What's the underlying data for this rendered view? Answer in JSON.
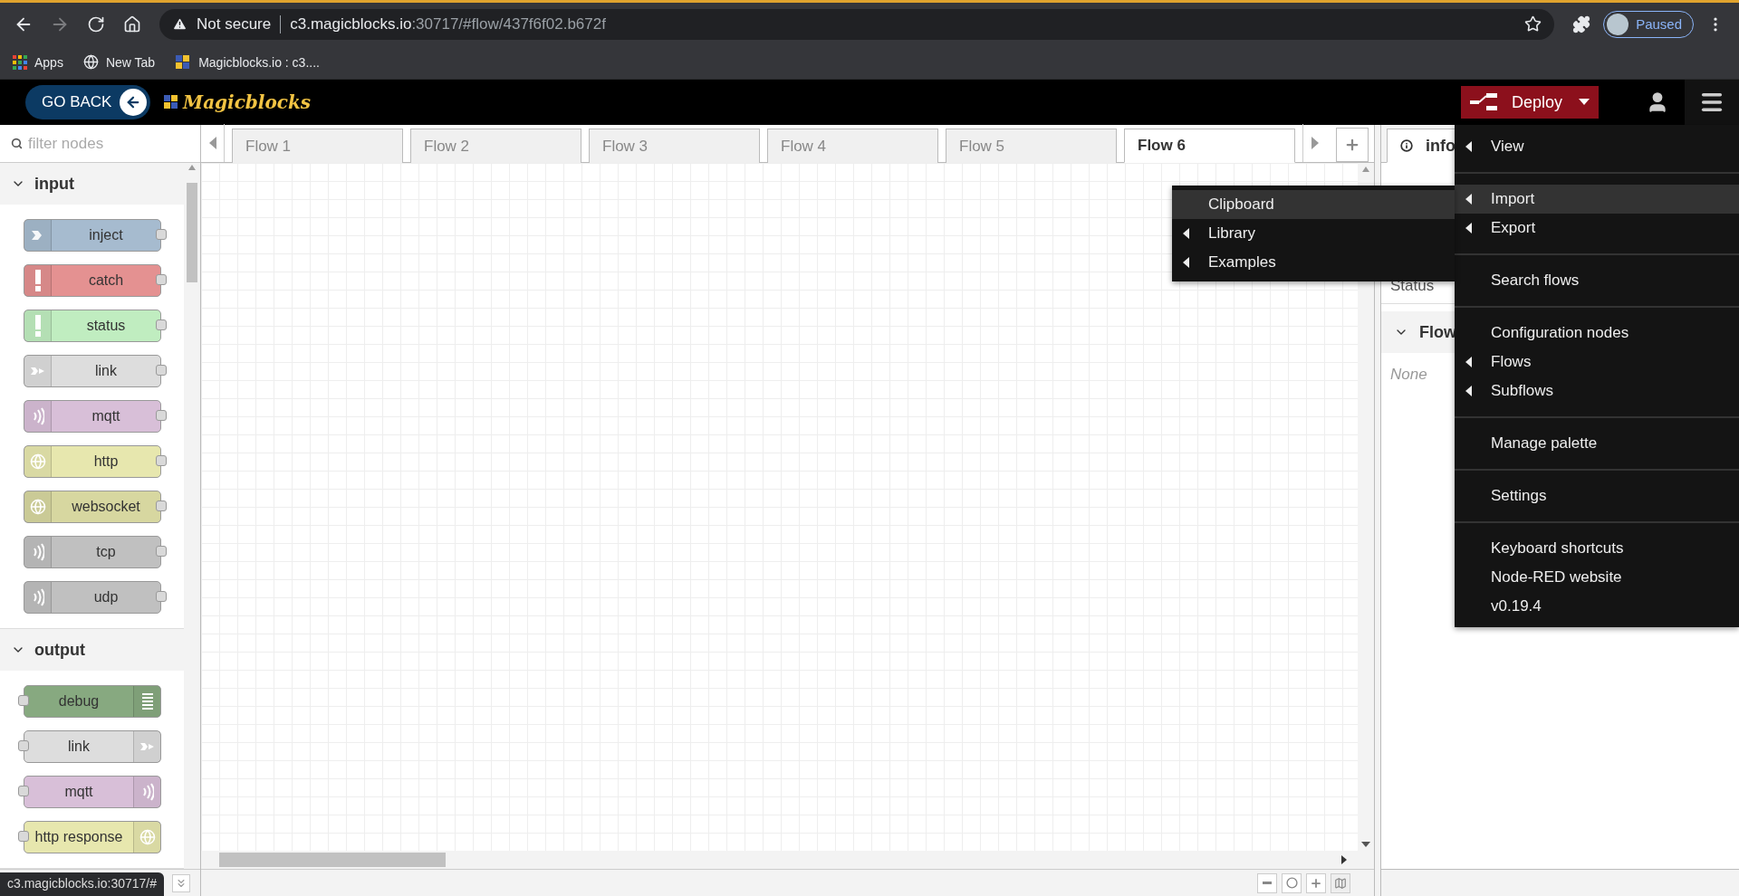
{
  "browser": {
    "security": "Not secure",
    "url_host": "c3.magicblocks.io",
    "url_rest": ":30717/#flow/437f6f02.b672f",
    "profile": "Paused",
    "forward_disabled": true
  },
  "bookmarks": [
    {
      "label": "Apps",
      "kind": "apps"
    },
    {
      "label": "New Tab",
      "kind": "globe"
    },
    {
      "label": "Magicblocks.io : c3....",
      "kind": "site"
    }
  ],
  "header": {
    "back_button": "GO BACK",
    "logo": "Magicblocks",
    "deploy": "Deploy",
    "menu_open": true
  },
  "palette": {
    "filter_placeholder": "filter nodes",
    "categories": [
      {
        "name": "input",
        "kind": "source",
        "expanded": true,
        "nodes": [
          {
            "label": "inject",
            "color": "#a6bbcf",
            "kind": "arrow"
          },
          {
            "label": "catch",
            "color": "#e49191",
            "kind": "alert"
          },
          {
            "label": "status",
            "color": "#c0edc0",
            "kind": "alert"
          },
          {
            "label": "link",
            "color": "#dddddd",
            "kind": "link"
          },
          {
            "label": "mqtt",
            "color": "#d8bfd8",
            "kind": "wave"
          },
          {
            "label": "http",
            "color": "#e7e7ae",
            "kind": "globe"
          },
          {
            "label": "websocket",
            "color": "#d7d7a0",
            "kind": "globe"
          },
          {
            "label": "tcp",
            "color": "#c0c0c0",
            "kind": "wave"
          },
          {
            "label": "udp",
            "color": "#c0c0c0",
            "kind": "wave"
          }
        ]
      },
      {
        "name": "output",
        "kind": "sink",
        "expanded": true,
        "nodes": [
          {
            "label": "debug",
            "color": "#87a980",
            "kind": "list"
          },
          {
            "label": "link",
            "color": "#dddddd",
            "kind": "link"
          },
          {
            "label": "mqtt",
            "color": "#d8bfd8",
            "kind": "wave"
          },
          {
            "label": "http response",
            "color": "#e7e7ae",
            "kind": "globe"
          }
        ]
      }
    ]
  },
  "tabs": [
    {
      "label": "Flow 1",
      "selected": false
    },
    {
      "label": "Flow 2",
      "selected": false
    },
    {
      "label": "Flow 3",
      "selected": false
    },
    {
      "label": "Flow 4",
      "selected": false
    },
    {
      "label": "Flow 5",
      "selected": false
    },
    {
      "label": "Flow 6",
      "selected": true
    }
  ],
  "sidebar": {
    "tab": "info",
    "status_label": "Status",
    "section": "Flow",
    "section_expanded": true,
    "empty_text": "None"
  },
  "menu": {
    "groups": [
      [
        {
          "label": "View",
          "submenu": true,
          "selected": false
        }
      ],
      [
        {
          "label": "Import",
          "submenu": true,
          "selected": true
        },
        {
          "label": "Export",
          "submenu": true,
          "selected": false
        }
      ],
      [
        {
          "label": "Search flows",
          "submenu": false,
          "selected": false
        }
      ],
      [
        {
          "label": "Configuration nodes",
          "submenu": false,
          "selected": false
        },
        {
          "label": "Flows",
          "submenu": true,
          "selected": false
        },
        {
          "label": "Subflows",
          "submenu": true,
          "selected": false
        }
      ],
      [
        {
          "label": "Manage palette",
          "submenu": false,
          "selected": false
        }
      ],
      [
        {
          "label": "Settings",
          "submenu": false,
          "selected": false
        }
      ],
      [
        {
          "label": "Keyboard shortcuts",
          "submenu": false,
          "selected": false
        },
        {
          "label": "Node-RED website",
          "submenu": false,
          "selected": false
        },
        {
          "label": "v0.19.4",
          "submenu": false,
          "selected": false
        }
      ]
    ]
  },
  "submenu": {
    "items": [
      {
        "label": "Clipboard",
        "submenu": false,
        "selected": true
      },
      {
        "label": "Library",
        "submenu": true,
        "selected": false
      },
      {
        "label": "Examples",
        "submenu": true,
        "selected": false
      }
    ]
  },
  "status_bar": {
    "link": "c3.magicblocks.io:30717/#"
  }
}
